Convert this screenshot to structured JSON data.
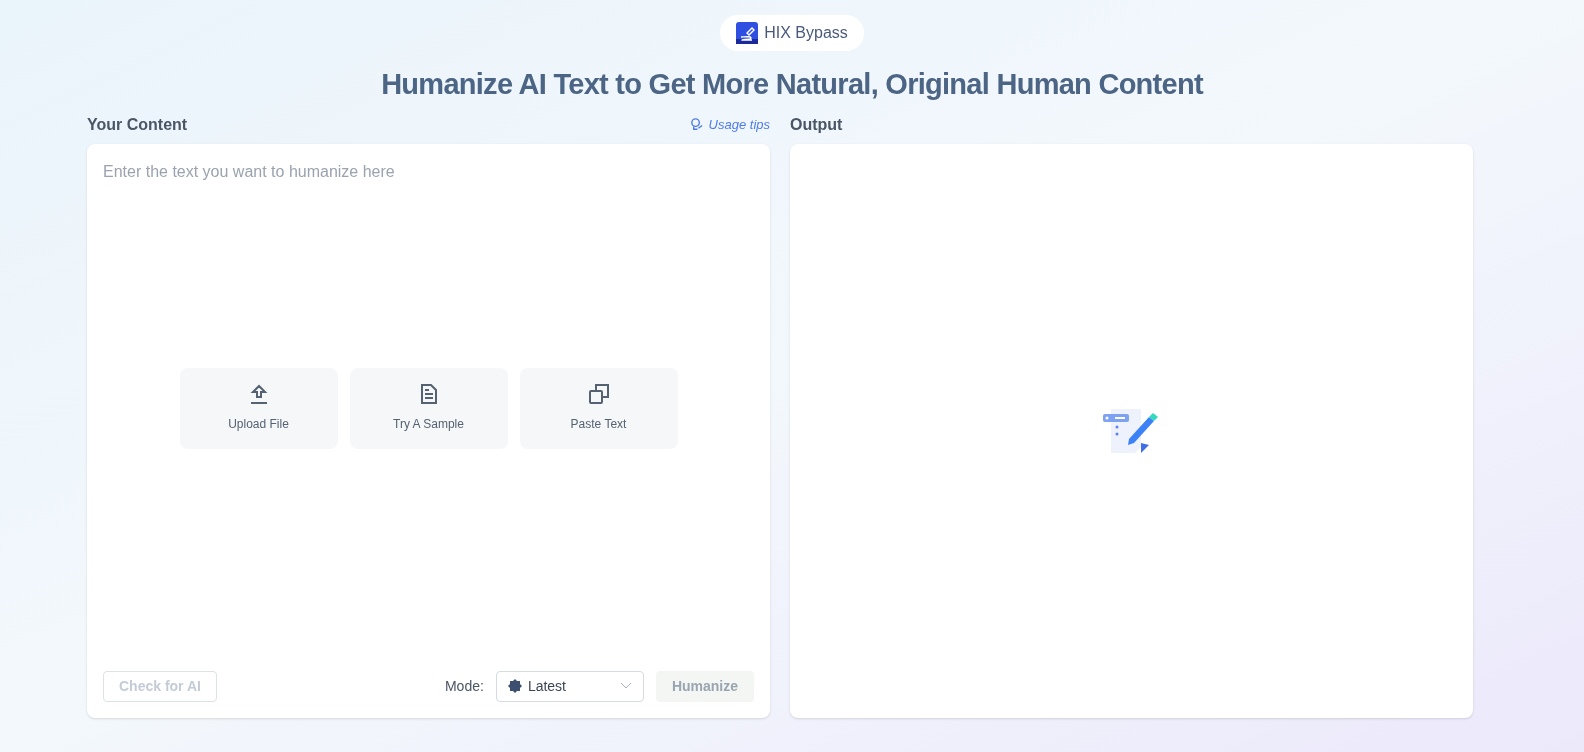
{
  "brand": {
    "name": "HIX Bypass"
  },
  "headline": "Humanize AI Text to Get More Natural, Original Human Content",
  "input_panel": {
    "label": "Your Content",
    "usage_tips": "Usage tips",
    "placeholder": "Enter the text you want to humanize here",
    "actions": [
      {
        "kind": "upload",
        "label": "Upload File"
      },
      {
        "kind": "sample",
        "label": "Try A Sample"
      },
      {
        "kind": "paste",
        "label": "Paste Text"
      }
    ],
    "check_button": {
      "label": "Check for AI",
      "disabled": true
    },
    "mode": {
      "label": "Mode:",
      "value": "Latest"
    },
    "humanize_button": {
      "label": "Humanize",
      "disabled": true
    }
  },
  "output_panel": {
    "label": "Output"
  }
}
